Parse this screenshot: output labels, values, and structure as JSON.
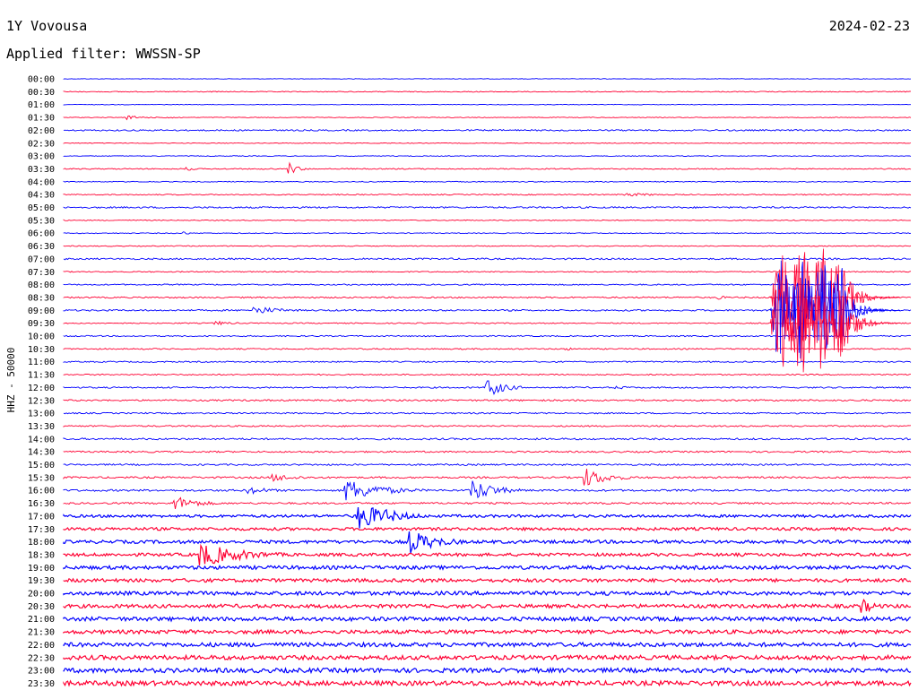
{
  "header": {
    "station": "1Y Vovousa",
    "date": "2024-02-23",
    "filter": "Applied filter: WWSSN-SP"
  },
  "chart_data": {
    "type": "line",
    "title": "1Y Vovousa",
    "subtitle": "Applied filter: WWSSN-SP",
    "ylabel": "HHZ - 50000",
    "colors": [
      "#0000ff",
      "#ff0033"
    ],
    "grid": false,
    "x": "minutes 0–30 within each row",
    "time_labels": [
      "00:00",
      "00:30",
      "01:00",
      "01:30",
      "02:00",
      "02:30",
      "03:00",
      "03:30",
      "04:00",
      "04:30",
      "05:00",
      "05:30",
      "06:00",
      "06:30",
      "07:00",
      "07:30",
      "08:00",
      "08:30",
      "09:00",
      "09:30",
      "10:00",
      "10:30",
      "11:00",
      "11:30",
      "12:00",
      "12:30",
      "13:00",
      "13:30",
      "14:00",
      "14:30",
      "15:00",
      "15:30",
      "16:00",
      "16:30",
      "17:00",
      "17:30",
      "18:00",
      "18:30",
      "19:00",
      "19:30",
      "20:00",
      "20:30",
      "21:00",
      "21:30",
      "22:00",
      "22:30",
      "23:00",
      "23:30"
    ],
    "noise_level": [
      0.3,
      0.5,
      0.3,
      0.4,
      0.8,
      0.4,
      0.4,
      0.6,
      0.5,
      0.6,
      0.9,
      0.5,
      0.5,
      0.5,
      0.9,
      0.6,
      0.7,
      0.8,
      0.9,
      0.6,
      0.7,
      0.7,
      0.7,
      0.7,
      0.8,
      0.9,
      0.8,
      0.8,
      1.0,
      0.9,
      0.9,
      1.0,
      1.1,
      1.0,
      1.5,
      1.6,
      1.8,
      1.7,
      2.0,
      1.9,
      2.1,
      2.0,
      2.2,
      2.1,
      2.3,
      2.4,
      2.5,
      2.6
    ],
    "events": [
      {
        "row": 3,
        "minute": 2.2,
        "amp": 2.5,
        "dur": 0.6
      },
      {
        "row": 3,
        "minute": 3.6,
        "amp": 2,
        "dur": 0.4
      },
      {
        "row": 7,
        "minute": 4.3,
        "amp": 5,
        "dur": 0.2
      },
      {
        "row": 7,
        "minute": 7.9,
        "amp": 10,
        "dur": 0.3
      },
      {
        "row": 9,
        "minute": 19.8,
        "amp": 2,
        "dur": 1.5
      },
      {
        "row": 12,
        "minute": 4.2,
        "amp": 3,
        "dur": 0.2
      },
      {
        "row": 17,
        "minute": 23.1,
        "amp": 3,
        "dur": 0.3
      },
      {
        "row": 18,
        "minute": 6.7,
        "amp": 5,
        "dur": 1.0
      },
      {
        "row": 19,
        "minute": 5.3,
        "amp": 3,
        "dur": 0.6
      },
      {
        "row": 21,
        "minute": 17.7,
        "amp": 2,
        "dur": 0.5
      },
      {
        "row": 24,
        "minute": 14.9,
        "amp": 13,
        "dur": 0.6
      },
      {
        "row": 24,
        "minute": 19.5,
        "amp": 2,
        "dur": 0.8
      },
      {
        "row": 31,
        "minute": 7.3,
        "amp": 5,
        "dur": 1.0
      },
      {
        "row": 31,
        "minute": 18.4,
        "amp": 12,
        "dur": 0.8
      },
      {
        "row": 32,
        "minute": 6.5,
        "amp": 5,
        "dur": 0.8
      },
      {
        "row": 32,
        "minute": 9.9,
        "amp": 14,
        "dur": 1.2
      },
      {
        "row": 32,
        "minute": 14.4,
        "amp": 14,
        "dur": 0.8
      },
      {
        "row": 33,
        "minute": 3.9,
        "amp": 9,
        "dur": 0.8
      },
      {
        "row": 34,
        "minute": 10.3,
        "amp": 18,
        "dur": 1.0
      },
      {
        "row": 34,
        "minute": 11.1,
        "amp": 10,
        "dur": 1.0
      },
      {
        "row": 36,
        "minute": 12.2,
        "amp": 14,
        "dur": 1.0
      },
      {
        "row": 37,
        "minute": 4.8,
        "amp": 14,
        "dur": 1.5
      },
      {
        "row": 41,
        "minute": 28.2,
        "amp": 9,
        "dur": 0.5
      }
    ],
    "earthquakes": [
      {
        "row": 17,
        "start_minute": 25.0,
        "end_minute": 27.6,
        "amp_rows": 4.0,
        "coda_minutes": 2.0
      },
      {
        "row": 18,
        "start_minute": 25.0,
        "end_minute": 27.6,
        "amp_rows": 4.0,
        "coda_minutes": 2.0
      },
      {
        "row": 19,
        "start_minute": 25.0,
        "end_minute": 27.6,
        "amp_rows": 4.0,
        "coda_minutes": 2.0
      }
    ]
  }
}
